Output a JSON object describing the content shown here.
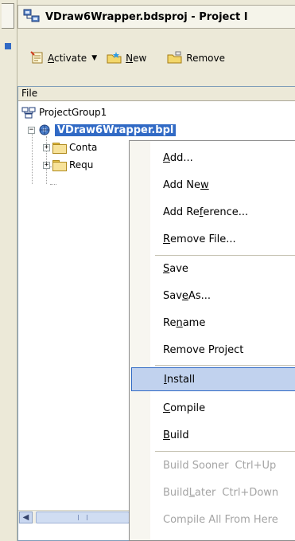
{
  "window": {
    "title": "VDraw6Wrapper.bdsproj - Project I"
  },
  "toolbar": {
    "activate_label_pre": "",
    "activate_label_u": "A",
    "activate_label_post": "ctivate",
    "new_label_u": "N",
    "new_label_post": "ew",
    "remove_label": "Remove"
  },
  "tree": {
    "column_header": "File",
    "items": [
      {
        "label": "ProjectGroup1"
      },
      {
        "label": "VDraw6Wrapper.bpl"
      },
      {
        "label": "Conta"
      },
      {
        "label": "Requ"
      }
    ]
  },
  "context_menu": {
    "items": [
      {
        "pre": "",
        "u": "A",
        "post": "dd..."
      },
      {
        "pre": "Add Ne",
        "u": "w",
        "post": ""
      },
      {
        "pre": "Add Re",
        "u": "f",
        "post": "erence..."
      },
      {
        "pre": "",
        "u": "R",
        "post": "emove File..."
      },
      {
        "pre": "",
        "u": "S",
        "post": "ave"
      },
      {
        "pre": "Sav",
        "u": "e",
        "post": " As..."
      },
      {
        "pre": "Re",
        "u": "n",
        "post": "ame"
      },
      {
        "pre": "Remove Project",
        "u": "",
        "post": ""
      },
      {
        "pre": "",
        "u": "I",
        "post": "nstall"
      },
      {
        "pre": "",
        "u": "C",
        "post": "ompile"
      },
      {
        "pre": "",
        "u": "B",
        "post": "uild"
      },
      {
        "pre": "Build Sooner",
        "u": "",
        "post": "",
        "shortcut": "Ctrl+Up"
      },
      {
        "pre": "Build ",
        "u": "L",
        "post": "ater",
        "shortcut": "Ctrl+Down"
      },
      {
        "pre": "Compile All From Here",
        "u": "",
        "post": ""
      }
    ]
  },
  "colors": {
    "selection": "#316ac5",
    "menu_highlight": "#c1d2ee",
    "disabled_text": "#a4a4a4"
  }
}
